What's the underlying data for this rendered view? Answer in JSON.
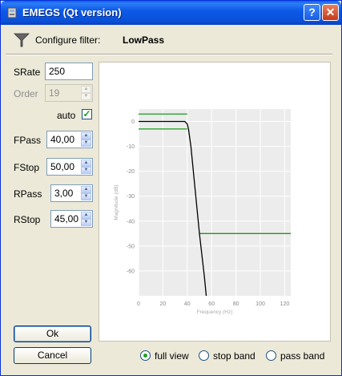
{
  "window": {
    "title": "EMEGS (Qt version)",
    "help_label": "?",
    "close_label": "✕"
  },
  "header": {
    "configure_label": "Configure filter:",
    "filter_name": "LowPass"
  },
  "form": {
    "srate": {
      "label": "SRate",
      "value": "250"
    },
    "order": {
      "label": "Order",
      "value": "19"
    },
    "auto": {
      "label": "auto",
      "checked": true
    },
    "fpass": {
      "label": "FPass",
      "value": "40,00"
    },
    "fstop": {
      "label": "FStop",
      "value": "50,00"
    },
    "rpass": {
      "label": "RPass",
      "value": "3,00"
    },
    "rstop": {
      "label": "RStop",
      "value": "45,00"
    }
  },
  "buttons": {
    "ok": "Ok",
    "cancel": "Cancel"
  },
  "view_options": [
    {
      "label": "full view",
      "selected": true
    },
    {
      "label": "stop band",
      "selected": false
    },
    {
      "label": "pass band",
      "selected": false
    }
  ],
  "chart_data": {
    "type": "line",
    "xlabel": "Frequency (Hz)",
    "ylabel": "Magnitude (dB)",
    "xlim": [
      0,
      125
    ],
    "ylim": [
      -70,
      5
    ],
    "x_ticks": [
      0,
      20,
      40,
      60,
      80,
      100,
      120
    ],
    "y_ticks": [
      0,
      -10,
      -20,
      -30,
      -40,
      -50,
      -60
    ],
    "grid": true,
    "series": [
      {
        "x": [
          0,
          38,
          40,
          41,
          43,
          46,
          50,
          54,
          56
        ],
        "y": [
          0,
          0,
          -1,
          -3,
          -10,
          -25,
          -45,
          -62,
          -72
        ],
        "color": "#000000"
      }
    ],
    "limit_lines": [
      {
        "x": [
          0,
          40
        ],
        "y": [
          3,
          3
        ],
        "color": "#1a9a1a"
      },
      {
        "x": [
          0,
          40
        ],
        "y": [
          -3,
          -3
        ],
        "color": "#1a9a1a"
      },
      {
        "x": [
          50,
          125
        ],
        "y": [
          -45,
          -45
        ],
        "color": "#1a9a1a"
      }
    ]
  }
}
